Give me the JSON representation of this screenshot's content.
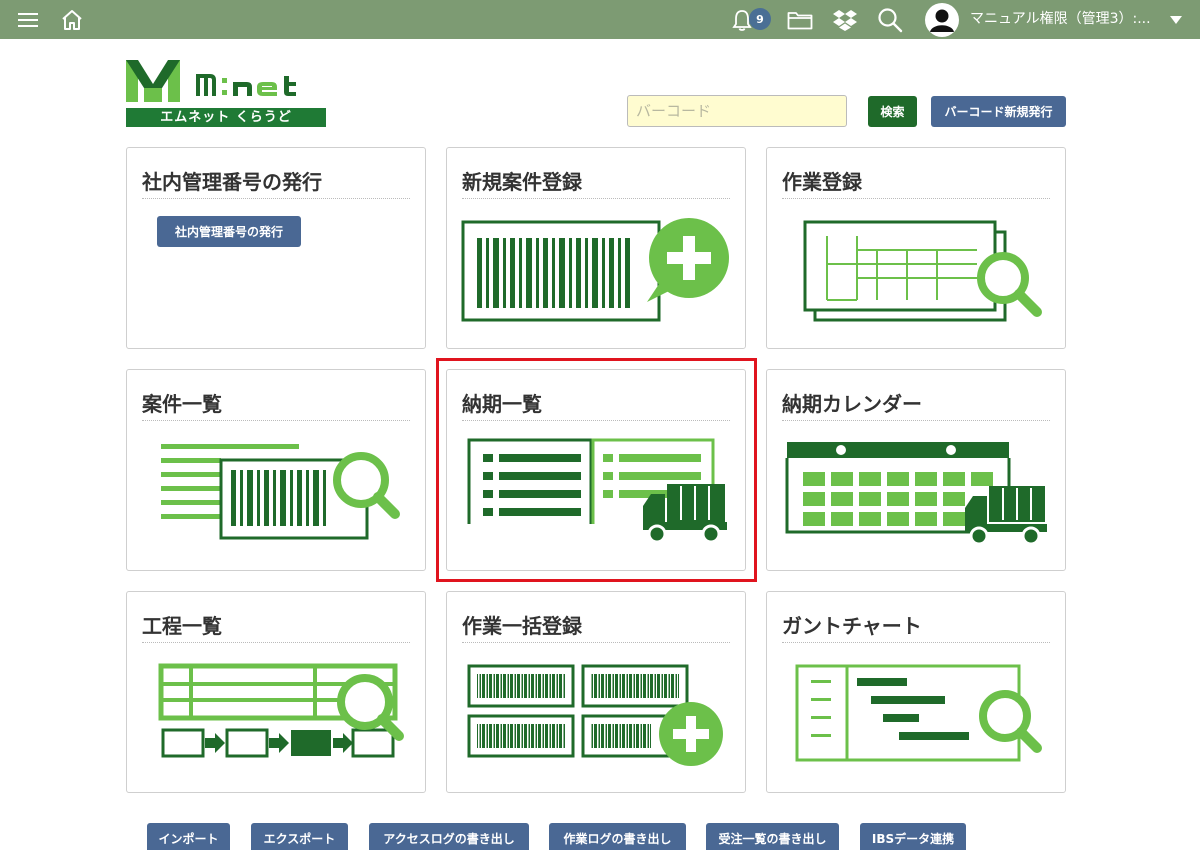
{
  "topbar": {
    "notification_count": "9",
    "user_name": "マニュアル権限（管理3）:..."
  },
  "logo": {
    "brand": "M:net",
    "subtitle": "エムネット くらうど"
  },
  "search": {
    "placeholder": "バーコード",
    "search_label": "検索",
    "new_barcode_label": "バーコード新規発行"
  },
  "cards": [
    {
      "title": "社内管理番号の発行",
      "button": "社内管理番号の発行"
    },
    {
      "title": "新規案件登録"
    },
    {
      "title": "作業登録"
    },
    {
      "title": "案件一覧"
    },
    {
      "title": "納期一覧"
    },
    {
      "title": "納期カレンダー"
    },
    {
      "title": "工程一覧"
    },
    {
      "title": "作業一括登録"
    },
    {
      "title": "ガントチャート"
    }
  ],
  "bottom_buttons": [
    "インポート",
    "エクスポート",
    "アクセスログの書き出し",
    "作業ログの書き出し",
    "受注一覧の書き出し",
    "IBSデータ連携"
  ],
  "colors": {
    "topbar": "#7d9b73",
    "dark_green": "#1f6a2a",
    "light_green": "#6cc04a",
    "button_blue": "#4a6894",
    "highlight_red": "#e0141e"
  }
}
